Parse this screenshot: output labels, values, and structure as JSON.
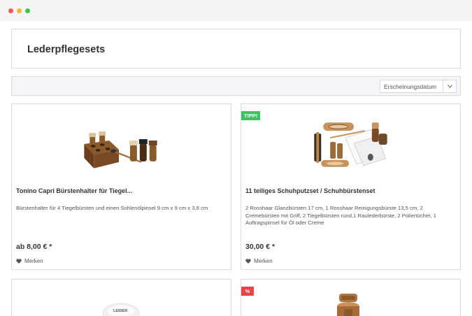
{
  "window": {
    "controls": [
      "close",
      "minimize",
      "maximize"
    ]
  },
  "page": {
    "title": "Lederpflegesets"
  },
  "toolbar": {
    "sort_value": "Erscheinungsdatum"
  },
  "products": [
    {
      "name": "Tonino Capri Bürstenhalter für Tiegel...",
      "description": "Bürstenhalter für 4 Tiegelbürsten und einen Sohlenölpinsel 9 cm x 9 cm x 3,8 cm",
      "price": "ab 8,00 € *",
      "wishlist_label": "Merken",
      "badge": ""
    },
    {
      "name": "11 teiliges Schuhputzset / Schuhbürstenset",
      "description": "2 Rosshaar Glanzbürsten 17 cm, 1 Rosshaar Reinigungsbürste 13,5 cm, 2 Cremebürsten mit Griff, 2 Tiegelbürsten rund,1 Raulederbürste, 2 Poliertücher, 1 Auftragspinsel für Öl oder Creme",
      "price": "30,00 € *",
      "wishlist_label": "Merken",
      "badge": "TIPP!"
    },
    {
      "badge": "",
      "image_text": "LEIDER"
    },
    {
      "badge": "%"
    }
  ],
  "colors": {
    "tipp_badge": "#3cc261",
    "sale_badge": "#e8444a",
    "border": "#dadae5"
  }
}
